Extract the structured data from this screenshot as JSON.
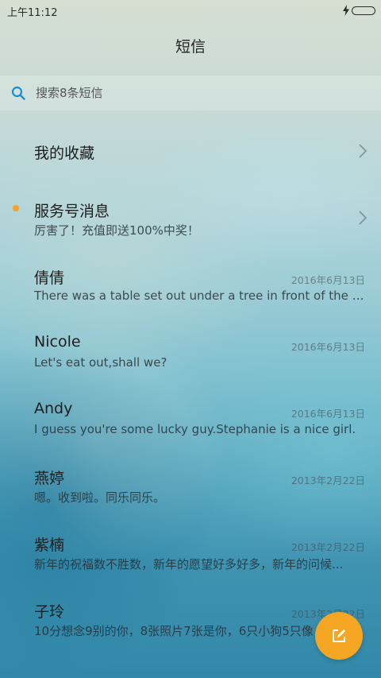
{
  "status_bar": {
    "time": "上午11:12",
    "icons": [
      "charging-icon",
      "battery-icon"
    ]
  },
  "header": {
    "title": "短信"
  },
  "search": {
    "placeholder": "搜索8条短信",
    "icon": "search-icon"
  },
  "favorites": {
    "label": "我的收藏",
    "icon": "chevron-right-icon"
  },
  "service": {
    "label": "服务号消息",
    "preview": "厉害了！充值即送100%中奖！",
    "unread_color": "#f4a324",
    "icon": "chevron-right-icon"
  },
  "conversations": [
    {
      "name": "倩倩",
      "date": "2016年6月13日",
      "preview": "There was a table set out under a tree in front of the ho..."
    },
    {
      "name": "Nicole",
      "date": "2016年6月13日",
      "preview": "Let's eat out,shall we?"
    },
    {
      "name": "Andy",
      "date": "2016年6月13日",
      "preview": "I guess you're some lucky guy.Stephanie is a nice girl."
    },
    {
      "name": "燕婷",
      "date": "2013年2月22日",
      "preview": "嗯。收到啦。同乐同乐。"
    },
    {
      "name": "紫楠",
      "date": "2013年2月22日",
      "preview": "新年的祝福数不胜数，新年的愿望好多好多，新年的问候..."
    },
    {
      "name": "子玲",
      "date": "2013年2月22日",
      "preview": "10分想念9别的你，8张照片7张是你，6只小狗5只像"
    }
  ],
  "compose": {
    "icon": "compose-icon",
    "color": "#f5a623"
  }
}
